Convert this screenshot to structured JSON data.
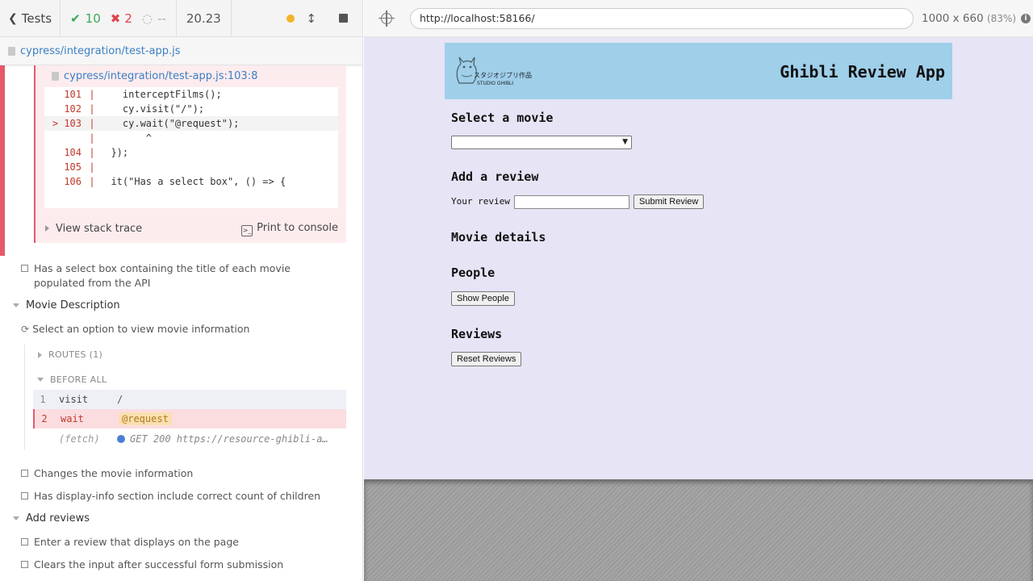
{
  "reporter": {
    "back_label": "Tests",
    "passed": "10",
    "failed": "2",
    "pending": "--",
    "duration": "20.23",
    "spec_file": "cypress/integration/test-app.js"
  },
  "error": {
    "file_ref": "cypress/integration/test-app.js:103:8",
    "code_lines": [
      {
        "ln": "101",
        "text": "    interceptFilms();"
      },
      {
        "ln": "102",
        "text": "    cy.visit(\"/\");"
      },
      {
        "ln": "> 103",
        "text": "    cy.wait(\"@request\");"
      },
      {
        "ln": "",
        "text": "        ^"
      },
      {
        "ln": "104",
        "text": "  });"
      },
      {
        "ln": "105",
        "text": ""
      },
      {
        "ln": "106",
        "text": "  it(\"Has a select box\", () => {"
      }
    ],
    "view_stack": "View stack trace",
    "print_console": "Print to console"
  },
  "tests": {
    "select_box_test": "Has a select box containing the title of each movie populated from the API",
    "suite_movie_desc": "Movie Description",
    "select_option_test": "Select an option to view movie information",
    "routes_label": "ROUTES (1)",
    "before_all_label": "BEFORE ALL",
    "commands": [
      {
        "num": "1",
        "name": "visit",
        "arg": "/"
      },
      {
        "num": "2",
        "name": "wait",
        "arg": "@request"
      },
      {
        "num": "",
        "name": "(fetch)",
        "arg": "GET 200 https://resource-ghibli-a…"
      }
    ],
    "changes_info": "Changes the movie information",
    "display_info": "Has display-info section include correct count of children",
    "suite_add_reviews": "Add reviews",
    "enter_review": "Enter a review that displays on the page",
    "clears_input": "Clears the input after successful form submission"
  },
  "aut": {
    "url": "http://localhost:58166/",
    "viewport": "1000 x 660",
    "scale": "(83%)"
  },
  "app": {
    "title": "Ghibli Review App",
    "logo_jp": "スタジオジブリ作品",
    "logo_en": "STUDIO GHIBLI",
    "select_heading": "Select a movie",
    "review_heading": "Add a review",
    "review_label": "Your review",
    "submit_label": "Submit Review",
    "details_heading": "Movie details",
    "people_heading": "People",
    "show_people": "Show People",
    "reviews_heading": "Reviews",
    "reset_reviews": "Reset Reviews"
  },
  "colors": {
    "pass": "#3aa856",
    "fail": "#e0424b",
    "app_bg": "#e6e4f5",
    "header_bg": "#9fcfe9"
  }
}
